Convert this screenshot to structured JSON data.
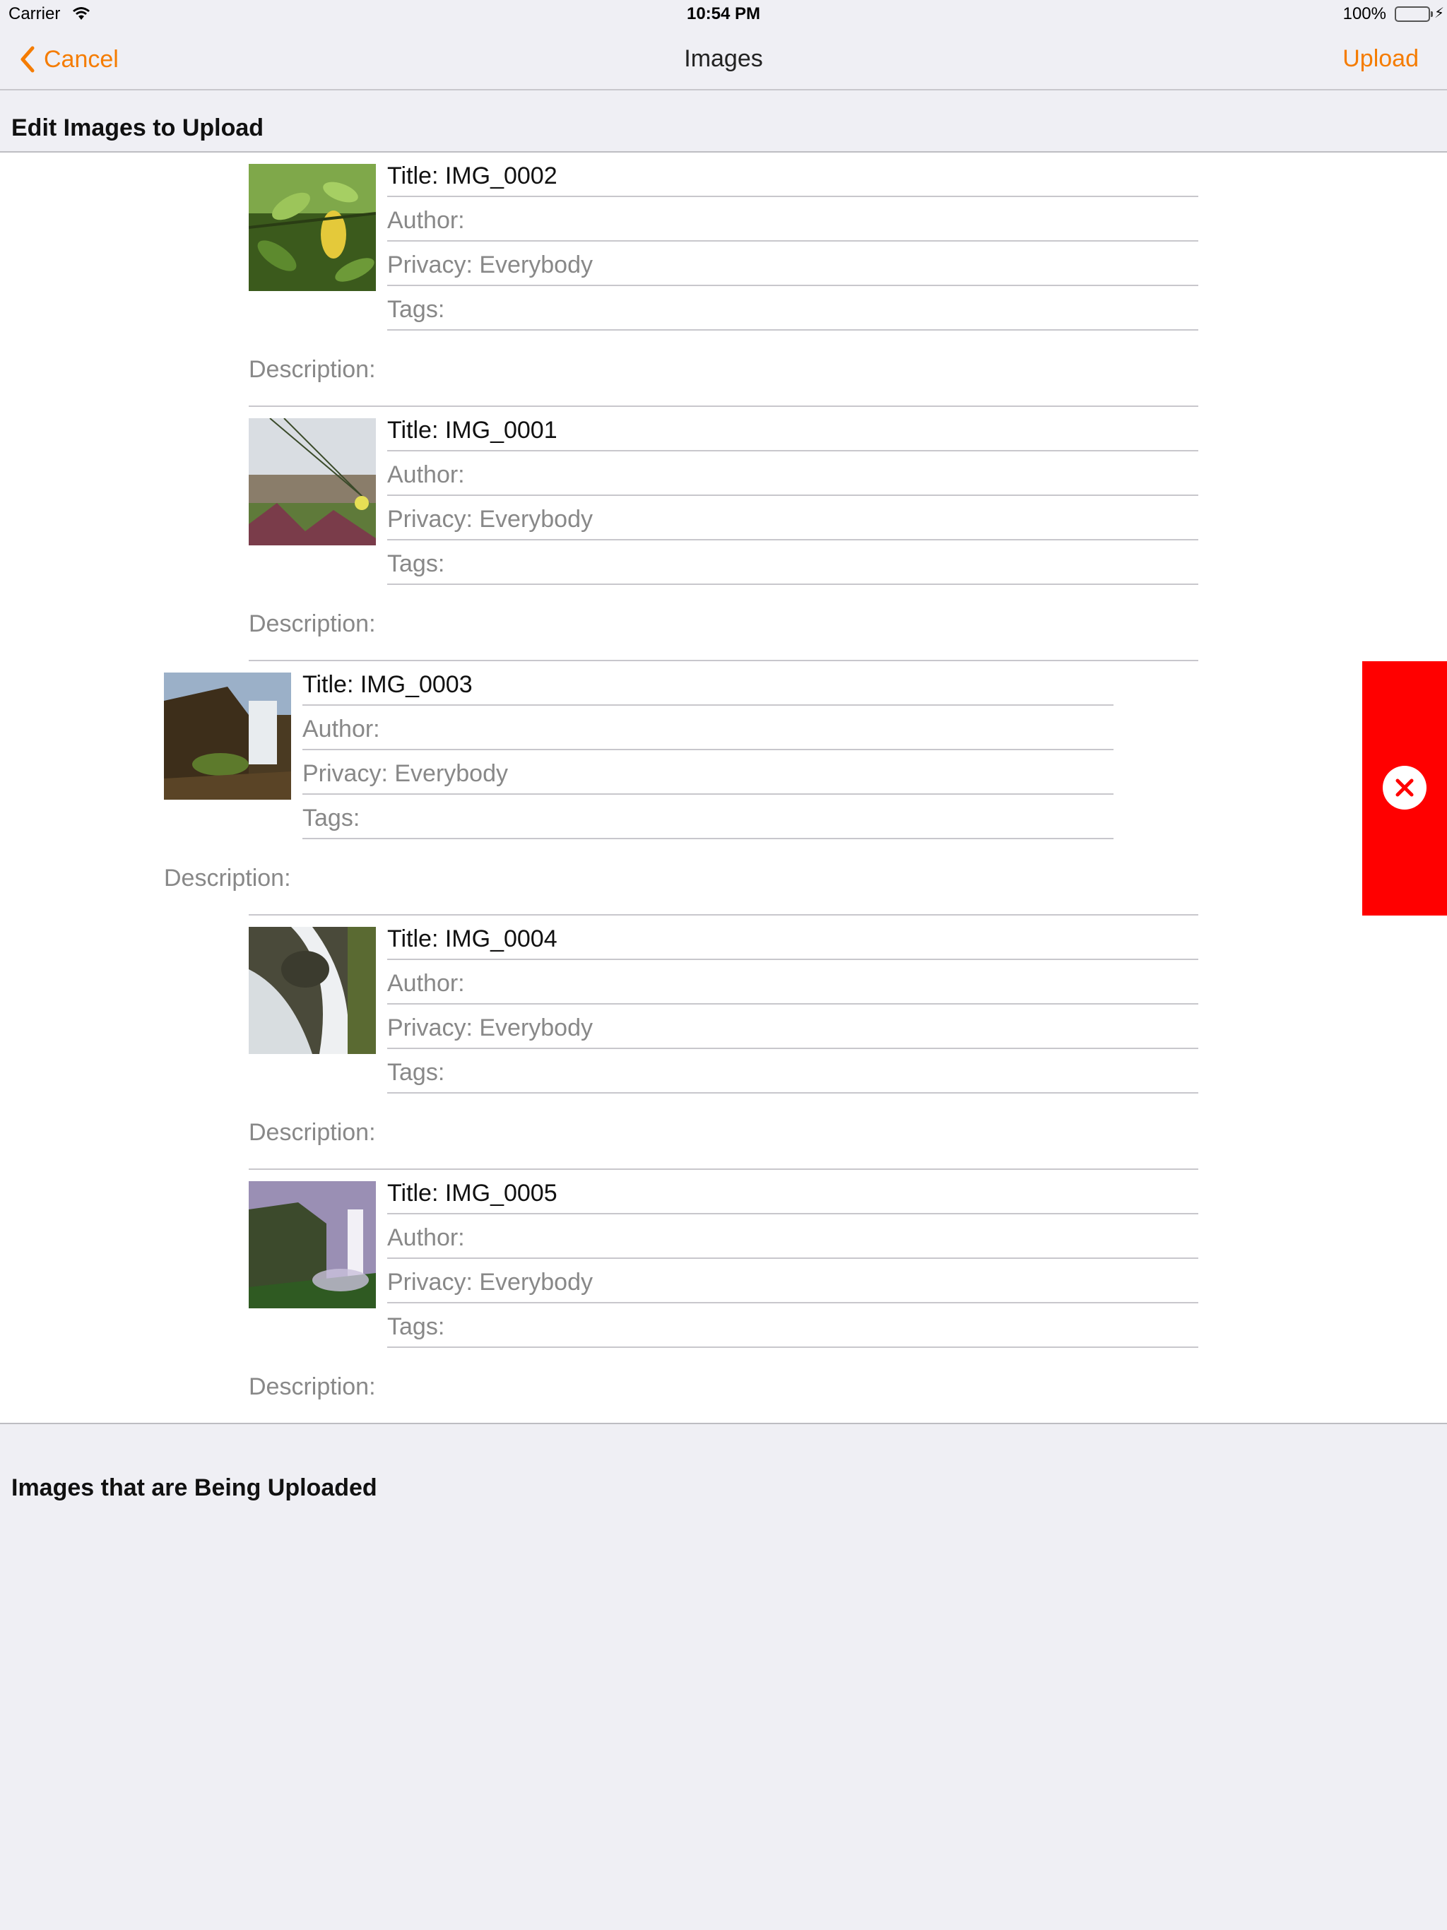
{
  "status_bar": {
    "carrier": "Carrier",
    "time": "10:54 PM",
    "battery": "100%"
  },
  "nav": {
    "back_label": "Cancel",
    "title": "Images",
    "upload_label": "Upload"
  },
  "sections": {
    "edit_header": "Edit Images to Upload",
    "uploading_header": "Images that are Being Uploaded"
  },
  "images": [
    {
      "title": "Title: IMG_0002",
      "author": "Author:",
      "privacy": "Privacy: Everybody",
      "tags": "Tags:",
      "description": "Description:"
    },
    {
      "title": "Title: IMG_0001",
      "author": "Author:",
      "privacy": "Privacy: Everybody",
      "tags": "Tags:",
      "description": "Description:"
    },
    {
      "title": "Title: IMG_0003",
      "author": "Author:",
      "privacy": "Privacy: Everybody",
      "tags": "Tags:",
      "description": "Description:"
    },
    {
      "title": "Title: IMG_0004",
      "author": "Author:",
      "privacy": "Privacy: Everybody",
      "tags": "Tags:",
      "description": "Description:"
    },
    {
      "title": "Title: IMG_0005",
      "author": "Author:",
      "privacy": "Privacy: Everybody",
      "tags": "Tags:",
      "description": "Description:"
    }
  ],
  "colors": {
    "accent": "#f57c00",
    "delete": "#ff0000"
  },
  "icons": {
    "back": "chevron-left-icon",
    "delete": "close-circle-icon"
  }
}
